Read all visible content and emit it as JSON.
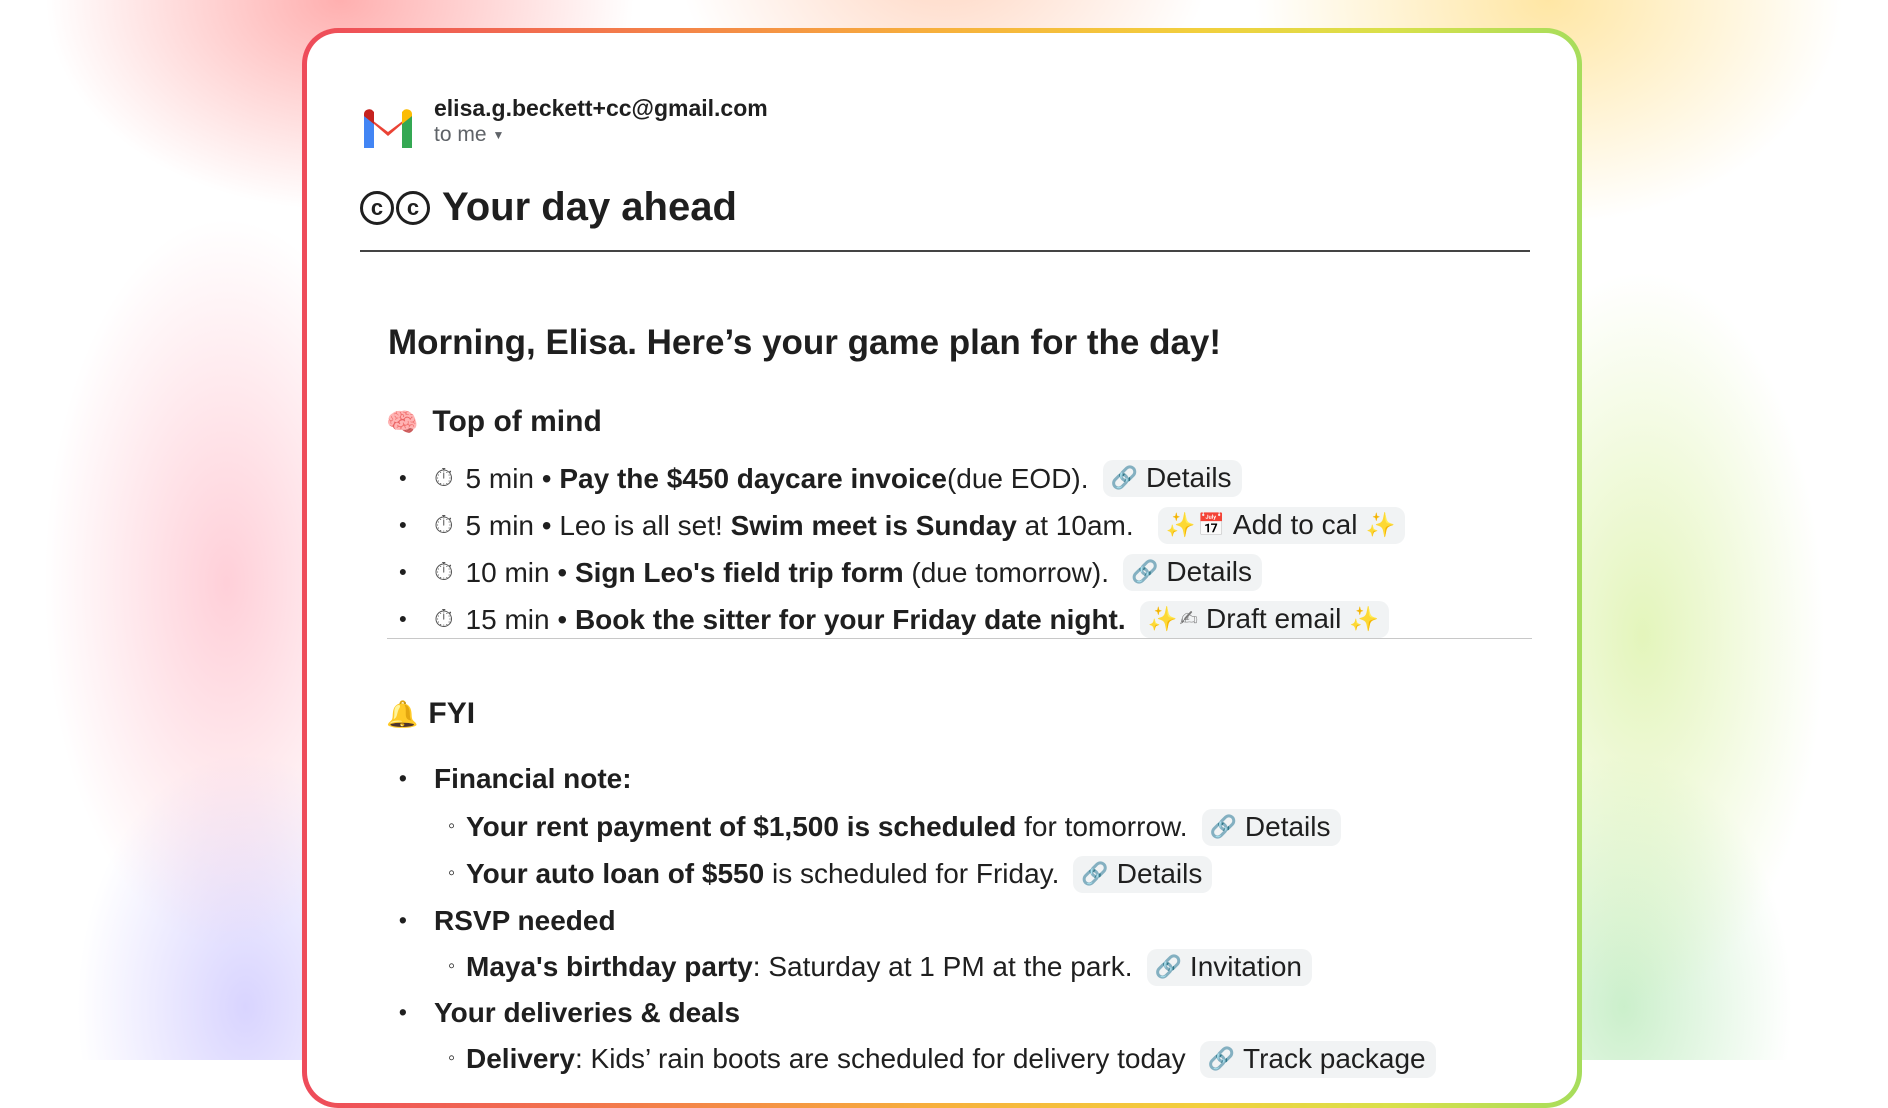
{
  "sender": {
    "email": "elisa.g.beckett+cc@gmail.com",
    "to": "to me",
    "logo_icon": "gmail-logo-icon"
  },
  "title": {
    "logo": "cc-logo-icon",
    "text": "Your day ahead"
  },
  "greeting": "Morning, Elisa. Here’s your game plan for the day!",
  "top_of_mind": {
    "heading": "Top of mind",
    "icon": "brain-icon",
    "items": [
      {
        "time": "5 min",
        "pre": "",
        "bold": "Pay the $450 daycare invoice",
        "post": " (due EOD).",
        "action": "Details",
        "action_icon": "link-icon"
      },
      {
        "time": "5 min",
        "pre": "Leo is all set! ",
        "bold": "Swim meet is Sunday",
        "post": " at 10am.",
        "action": "Add to cal",
        "action_icon": "calendar-icon"
      },
      {
        "time": "10 min",
        "pre": "",
        "bold": "Sign Leo's field trip form",
        "post": " (due tomorrow).",
        "action": "Details",
        "action_icon": "link-icon"
      },
      {
        "time": "15 min",
        "pre": "",
        "bold": "Book the sitter for your Friday date night.",
        "post": "",
        "action": "Draft email",
        "action_icon": "writing-hand-icon"
      }
    ]
  },
  "fyi": {
    "heading": "FYI",
    "icon": "bell-icon",
    "groups": [
      {
        "label": "Financial note:",
        "items": [
          {
            "bold": "Your rent payment of $1,500 is scheduled",
            "post": " for tomorrow.",
            "action": "Details"
          },
          {
            "bold": "Your auto loan of $550",
            "post": " is scheduled for Friday.",
            "action": "Details"
          }
        ]
      },
      {
        "label": "RSVP needed",
        "items": [
          {
            "bold": "Maya's birthday party",
            "post": ": Saturday at 1 PM at the park.",
            "action": "Invitation"
          }
        ]
      },
      {
        "label": "Your deliveries & deals",
        "items": [
          {
            "bold": "Delivery",
            "post": ": Kids’ rain boots are scheduled for delivery today",
            "action": "Track package"
          }
        ]
      }
    ]
  },
  "colors": {
    "gradient_border": [
      "#ee4b5a",
      "#f7b13c",
      "#a6dd5c"
    ],
    "chip_bg": "#f1f3f4"
  }
}
